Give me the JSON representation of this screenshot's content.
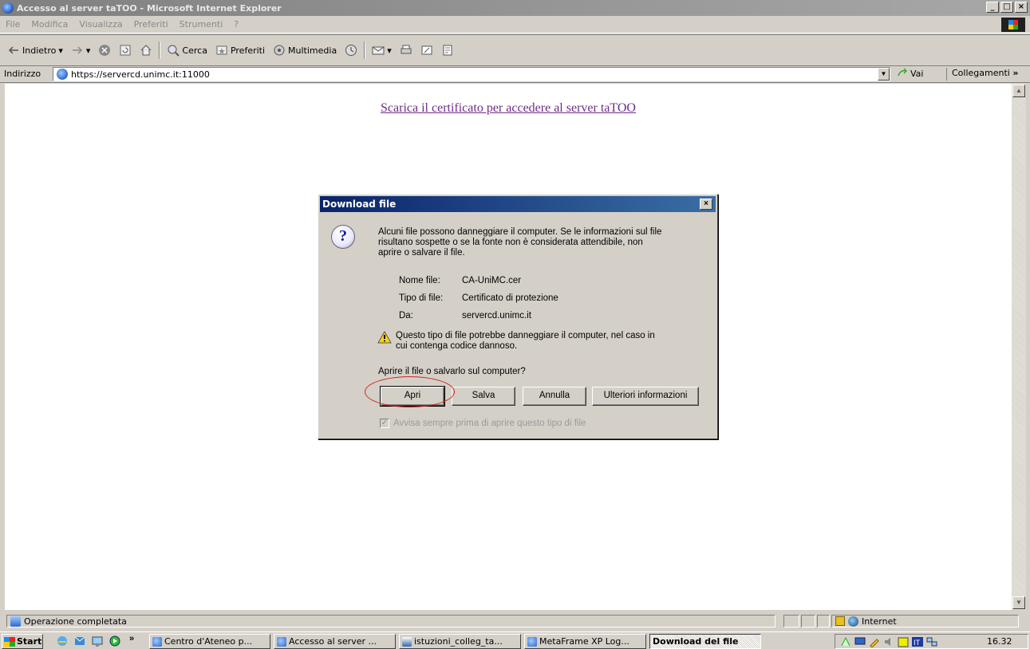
{
  "window": {
    "title": "Accesso al server taTOO - Microsoft Internet Explorer",
    "buttons": [
      "_",
      "□",
      "×"
    ]
  },
  "menu": [
    "File",
    "Modifica",
    "Visualizza",
    "Preferiti",
    "Strumenti",
    "?"
  ],
  "toolbar": {
    "back": "Indietro",
    "search": "Cerca",
    "favorites": "Preferiti",
    "media": "Multimedia"
  },
  "address": {
    "label": "Indirizzo",
    "url": "https://servercd.unimc.it:11000",
    "go": "Vai",
    "links": "Collegamenti"
  },
  "page": {
    "link_text": "Scarica il certificato per accedere al server taTOO"
  },
  "dialog": {
    "title": "Download file",
    "message_lines": [
      "Alcuni file possono danneggiare il computer. Se le informazioni sul file",
      "risultano sospette o se la fonte non è considerata attendibile, non",
      "aprire o salvare il file."
    ],
    "file_name_label": "Nome file:",
    "file_name": "CA-UniMC.cer",
    "file_type_label": "Tipo di file:",
    "file_type": "Certificato di protezione",
    "from_label": "Da:",
    "from": "servercd.unimc.it",
    "warning_lines": [
      "Questo tipo di file potrebbe danneggiare il computer, nel caso in",
      "cui contenga codice dannoso."
    ],
    "question": "Aprire il file o salvarlo sul computer?",
    "buttons": {
      "open": "Apri",
      "save": "Salva",
      "cancel": "Annulla",
      "more_info": "Ulteriori informazioni"
    },
    "checkbox_label": "Avvisa sempre prima di aprire questo tipo di file",
    "checkbox_checked": true
  },
  "status": {
    "text": "Operazione completata",
    "zone": "Internet"
  },
  "taskbar": {
    "start": "Start",
    "overflow": "»",
    "tasks": [
      "Centro d'Ateneo p...",
      "Accesso al server ...",
      "istuzioni_colleg_ta...",
      "MetaFrame XP Log...",
      "Download del file"
    ],
    "clock": "16.32"
  },
  "colors": {
    "dialog_title_start": "#0a246a",
    "dialog_title_end": "#3a6ea5",
    "highlight_circle": "#d42020",
    "link_visited": "#6f2a8a"
  }
}
